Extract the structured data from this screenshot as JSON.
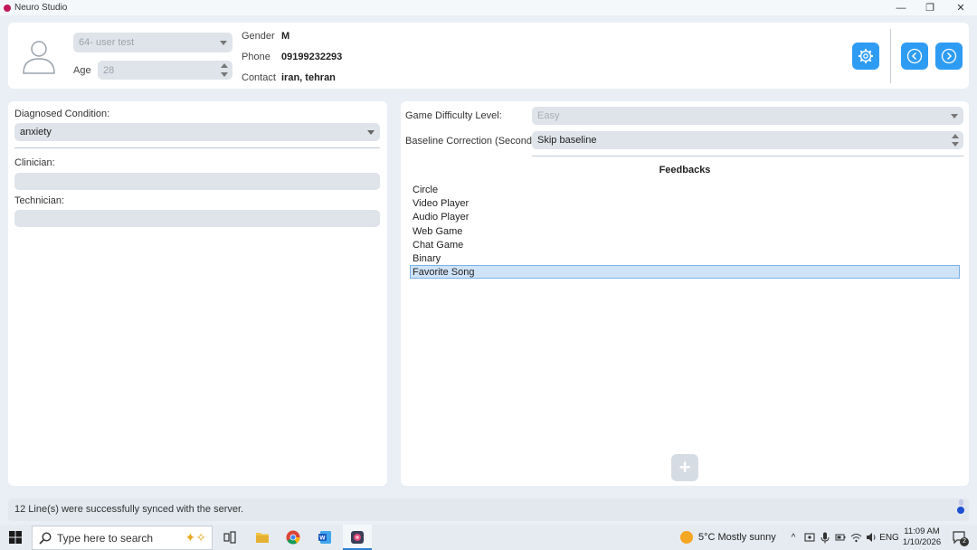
{
  "window": {
    "title": "Neuro Studio",
    "minimize_glyph": "—",
    "restore_glyph": "❐",
    "close_glyph": "✕"
  },
  "header": {
    "user_select_value": "64- user test",
    "age_label": "Age",
    "age_value": "28",
    "gender_label": "Gender",
    "gender_value": "M",
    "phone_label": "Phone",
    "phone_value": "09199232293",
    "contact_label": "Contact",
    "contact_value": "iran, tehran",
    "icons": [
      "user-avatar-icon",
      "gear-icon",
      "back-arrow-icon",
      "forward-arrow-icon"
    ]
  },
  "left_panel": {
    "diagnosed_label": "Diagnosed Condition:",
    "diagnosed_value": "anxiety",
    "clinician_label": "Clinician:",
    "clinician_value": "",
    "technician_label": "Technician:",
    "technician_value": ""
  },
  "right_panel": {
    "difficulty_label": "Game Difficulty Level:",
    "difficulty_value": "Easy",
    "baseline_label": "Baseline Correction (Seconds):",
    "baseline_value": "Skip baseline",
    "feedbacks_title": "Feedbacks",
    "feedbacks": [
      "Circle",
      "Video Player",
      "Audio Player",
      "Web Game",
      "Chat Game",
      "Binary",
      "Favorite Song"
    ],
    "selected_feedback": "Favorite Song",
    "add_glyph": "+"
  },
  "status": {
    "message": "12 Line(s) were successfully synced with the server."
  },
  "taskbar": {
    "search_placeholder": "Type here to search",
    "weather": "5°C  Mostly sunny",
    "language": "ENG",
    "time": "11:09 AM",
    "date": "1/10/2026",
    "notification_count": "2",
    "accent": "#2f9cf4"
  }
}
